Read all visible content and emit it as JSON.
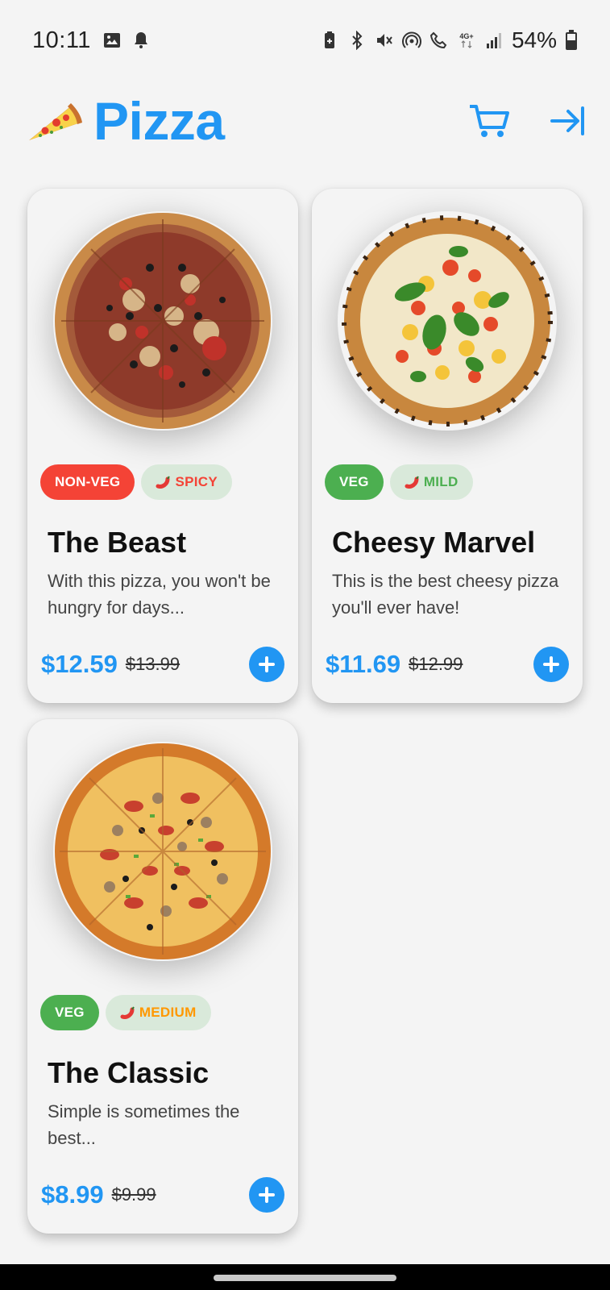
{
  "status": {
    "time": "10:11",
    "battery_pct": "54%",
    "network": "4G+",
    "left_icons": [
      "gallery-icon",
      "notification-bell-icon"
    ],
    "right_icons": [
      "battery-saver-icon",
      "bluetooth-icon",
      "mute-icon",
      "hotspot-icon",
      "wifi-call-icon",
      "network-4g-icon",
      "signal-icon",
      "battery-icon"
    ]
  },
  "app": {
    "title": "Pizza",
    "logo_icon": "pizza-slice-icon",
    "actions": [
      "cart-icon",
      "logout-icon"
    ],
    "accent_color": "#2196f3"
  },
  "pizzas": [
    {
      "name": "The Beast",
      "description": "With this pizza, you won't be hungry for days...",
      "diet": "NON-VEG",
      "spice": "SPICY",
      "price": "$12.59",
      "old_price": "$13.99"
    },
    {
      "name": "Cheesy Marvel",
      "description": "This is the best cheesy pizza you'll ever have!",
      "diet": "VEG",
      "spice": "MILD",
      "price": "$11.69",
      "old_price": "$12.99"
    },
    {
      "name": "The Classic",
      "description": "Simple is sometimes the best...",
      "diet": "VEG",
      "spice": "MEDIUM",
      "price": "$8.99",
      "old_price": "$9.99"
    }
  ],
  "colors": {
    "non_veg": "#f44336",
    "veg": "#4caf50",
    "spicy": "#f44336",
    "mild": "#4caf50",
    "medium": "#ff9800"
  }
}
